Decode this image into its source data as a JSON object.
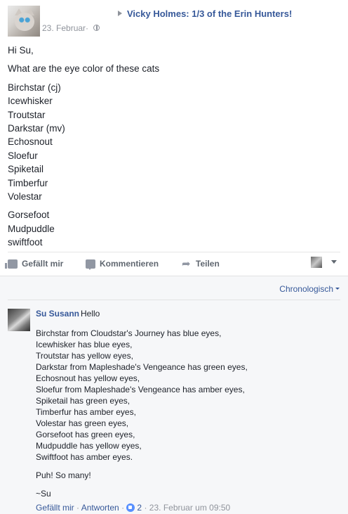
{
  "post": {
    "group_title": "Vicky Holmes: 1/3 of the Erin Hunters!",
    "date": "23. Februar",
    "date_separator": "·",
    "privacy_icon": "globe-icon",
    "body_lines_1": [
      "Hi Su,",
      "What are the eye color of these cats"
    ],
    "body_cats_1": [
      "Birchstar (cj)",
      "Icewhisker",
      "Troutstar",
      "Darkstar (mv)",
      "Echosnout",
      "Sloefur",
      "Spiketail",
      "Timberfur",
      "Volestar"
    ],
    "body_cats_2": [
      "Gorsefoot",
      "Mudpuddle",
      "swiftfoot"
    ]
  },
  "actions": {
    "like_label": "Gefällt mir",
    "comment_label": "Kommentieren",
    "share_label": "Teilen"
  },
  "comments": {
    "sort_label": "Chronologisch",
    "items": [
      {
        "author": "Su Susann",
        "first_line": "Hello",
        "lines": [
          "Birchstar from Cloudstar's Journey has blue eyes,",
          "Icewhisker has blue eyes,",
          "Troutstar has yellow eyes,",
          "Darkstar from Mapleshade's Vengeance has green eyes,",
          "Echosnout has yellow eyes,",
          "Sloefur from Mapleshade's Vengeance has amber eyes,",
          "Spiketail has green eyes,",
          "Timberfur has amber eyes,",
          "Volestar has green eyes,",
          "Gorsefoot has green eyes,",
          "Mudpuddle has yellow eyes,",
          "Swiftfoot has amber eyes."
        ],
        "extra": [
          "Puh! So many!",
          "~Su"
        ],
        "footer": {
          "like_label": "Gefällt mir",
          "reply_label": "Antworten",
          "like_count": "2",
          "timestamp": "23. Februar um 09:50",
          "separator": "·"
        }
      }
    ]
  },
  "colors": {
    "link": "#365899",
    "meta": "#90949c",
    "text": "#1d2129",
    "comment_bg": "#f6f7f9"
  }
}
